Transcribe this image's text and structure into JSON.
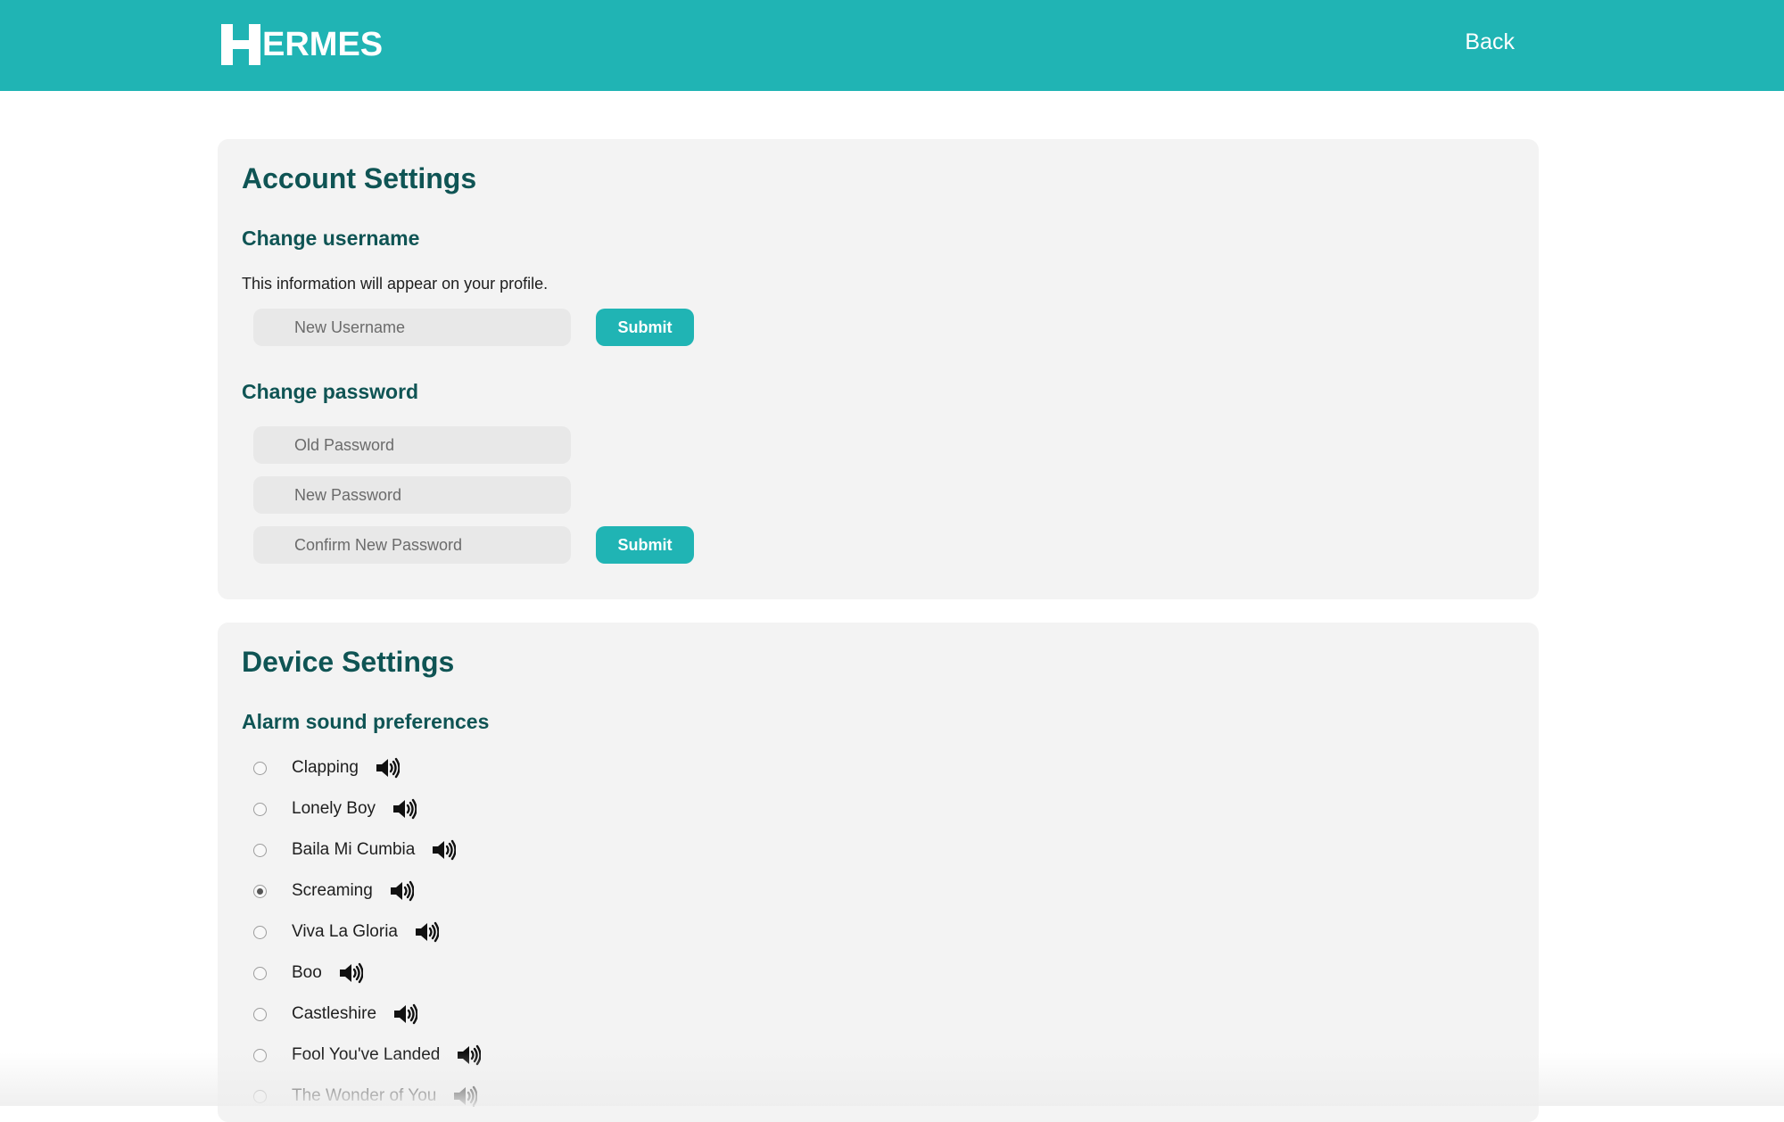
{
  "header": {
    "logo_letter": "H",
    "logo_text": "ERMES",
    "back_label": "Back"
  },
  "account": {
    "title": "Account Settings",
    "username": {
      "heading": "Change username",
      "helper": "This information will appear on your profile.",
      "placeholder": "New Username",
      "value": "",
      "submit_label": "Submit"
    },
    "password": {
      "heading": "Change password",
      "old_placeholder": "Old Password",
      "new_placeholder": "New Password",
      "confirm_placeholder": "Confirm New Password",
      "submit_label": "Submit"
    }
  },
  "device": {
    "title": "Device Settings",
    "alarm_heading": "Alarm sound preferences",
    "selected": "Screaming",
    "sounds": [
      {
        "label": "Clapping",
        "selected": false
      },
      {
        "label": "Lonely Boy",
        "selected": false
      },
      {
        "label": "Baila Mi Cumbia",
        "selected": false
      },
      {
        "label": "Screaming",
        "selected": true
      },
      {
        "label": "Viva La Gloria",
        "selected": false
      },
      {
        "label": "Boo",
        "selected": false
      },
      {
        "label": "Castleshire",
        "selected": false
      },
      {
        "label": "Fool You've Landed",
        "selected": false
      },
      {
        "label": "The Wonder of You",
        "selected": false
      }
    ],
    "preview_icon": "speaker-volume-icon"
  },
  "colors": {
    "brand": "#20b4b4",
    "heading": "#0f5454",
    "card": "#f3f3f3"
  }
}
